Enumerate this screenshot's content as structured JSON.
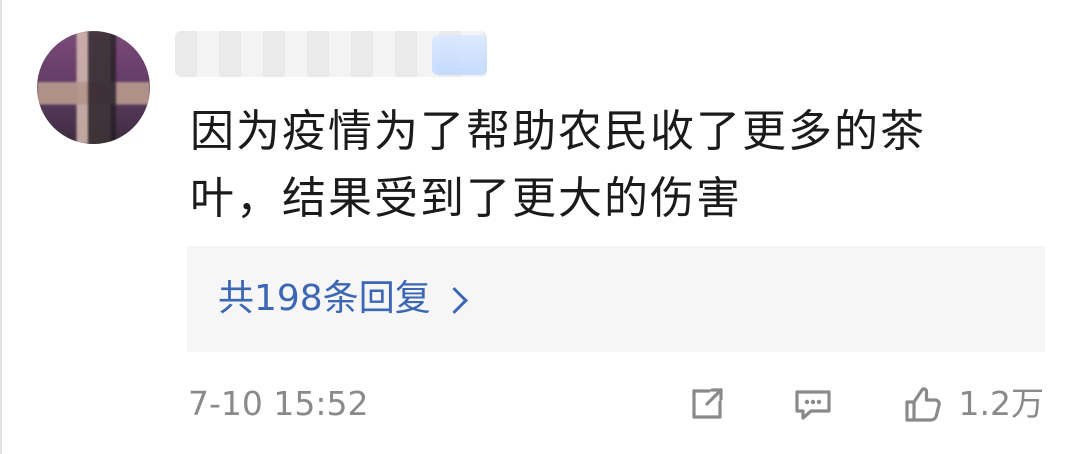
{
  "comment": {
    "text": "因为疫情为了帮助农民收了更多的茶\n叶，结果受到了更大的伤害"
  },
  "replies": {
    "label": "共198条回复",
    "chevron_icon": "chevron-right-icon"
  },
  "footer": {
    "timestamp": "7-10 15:52",
    "likes": "1.2万",
    "icons": {
      "share": "share-icon",
      "comment": "comment-icon",
      "like": "thumb-up-icon"
    }
  },
  "colors": {
    "link_blue": "#3b67b5",
    "text": "#1b1b1b",
    "muted": "#8a8a8a",
    "reply_bg": "#f6f6f6"
  }
}
